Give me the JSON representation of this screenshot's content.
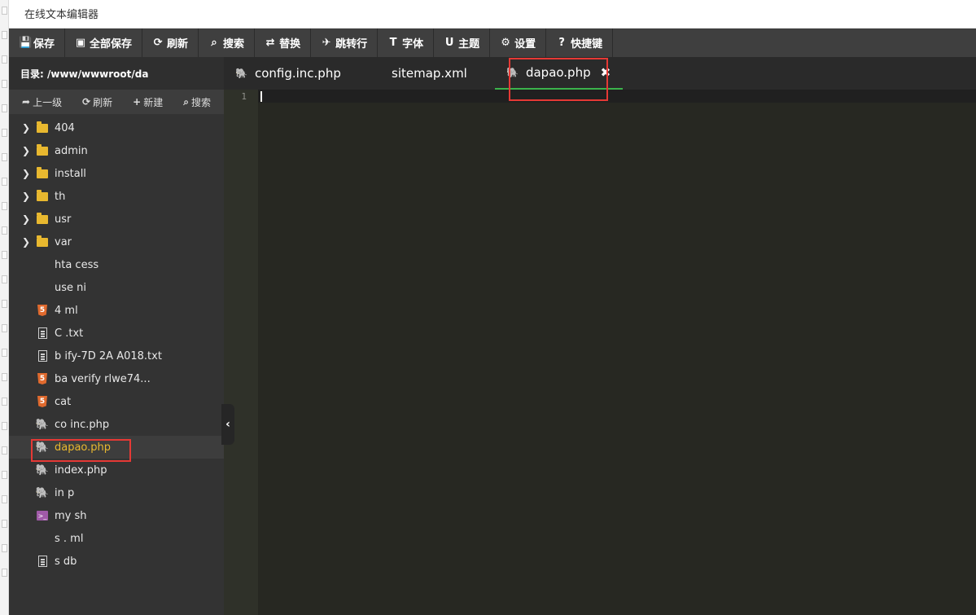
{
  "app": {
    "title": "在线文本编辑器"
  },
  "toolbar": [
    {
      "icon": "save-icon",
      "glyph": "💾",
      "label": "保存"
    },
    {
      "icon": "save-all-icon",
      "glyph": "▣",
      "label": "全部保存"
    },
    {
      "icon": "refresh-icon",
      "glyph": "⟳",
      "label": "刷新"
    },
    {
      "icon": "search-icon",
      "glyph": "⌕",
      "label": "搜索"
    },
    {
      "icon": "replace-icon",
      "glyph": "⇄",
      "label": "替换"
    },
    {
      "icon": "goto-line-icon",
      "glyph": "✈",
      "label": "跳转行"
    },
    {
      "icon": "font-icon",
      "glyph": "T",
      "label": "字体"
    },
    {
      "icon": "theme-icon",
      "glyph": "U",
      "label": "主题"
    },
    {
      "icon": "settings-gear-icon",
      "glyph": "⚙",
      "label": "设置"
    },
    {
      "icon": "help-icon",
      "glyph": "?",
      "label": "快捷键"
    }
  ],
  "sidebar": {
    "path": "目录: /www/wwwroot/da",
    "tools": [
      {
        "icon": "up-arrow-icon",
        "glyph": "➦",
        "label": "上一级"
      },
      {
        "icon": "refresh-icon",
        "glyph": "⟳",
        "label": "刷新"
      },
      {
        "icon": "plus-icon",
        "glyph": "+",
        "label": "新建"
      },
      {
        "icon": "search-icon",
        "glyph": "⌕",
        "label": "搜索"
      }
    ],
    "collapse_glyph": "‹",
    "files": [
      {
        "name": "404",
        "type": "folder"
      },
      {
        "name": "admin",
        "type": "folder"
      },
      {
        "name": "install",
        "type": "folder"
      },
      {
        "name": "th",
        "type": "folder"
      },
      {
        "name": "usr",
        "type": "folder"
      },
      {
        "name": "var",
        "type": "folder"
      },
      {
        "name": "hta   cess",
        "type": "plain"
      },
      {
        "name": "use   ni",
        "type": "plain"
      },
      {
        "name": "4     ml",
        "type": "html"
      },
      {
        "name": "C     .txt",
        "type": "text"
      },
      {
        "name": "b       ify-7D  2A  A018.txt",
        "type": "text"
      },
      {
        "name": "ba     verify         rlwe74...",
        "type": "html"
      },
      {
        "name": "cat",
        "type": "html"
      },
      {
        "name": "co    inc.php",
        "type": "php"
      },
      {
        "name": "dapao.php",
        "type": "php",
        "active": true
      },
      {
        "name": "index.php",
        "type": "php"
      },
      {
        "name": "in     p",
        "type": "php"
      },
      {
        "name": "my     sh",
        "type": "shell"
      },
      {
        "name": "s    .  ml",
        "type": "plain"
      },
      {
        "name": "s      db",
        "type": "text"
      }
    ]
  },
  "editor": {
    "tabs": [
      {
        "label": "config.inc.php",
        "active": false
      },
      {
        "label": "sitemap.xml",
        "active": false,
        "noicon": true
      },
      {
        "label": "dapao.php",
        "active": true
      }
    ],
    "close_glyph": "✖",
    "line_number": "1"
  }
}
